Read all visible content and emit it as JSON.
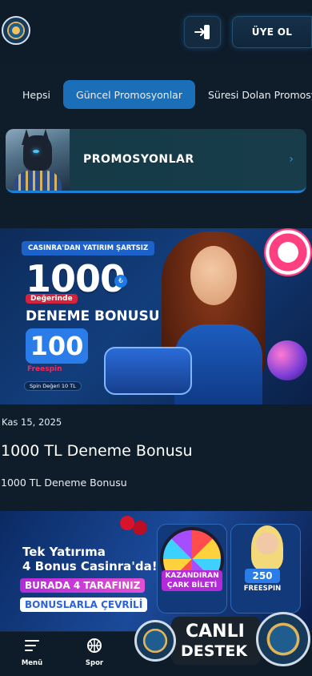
{
  "header": {
    "signup_label": "ÜYE OL"
  },
  "tabs": [
    {
      "label": "Hepsi",
      "active": false
    },
    {
      "label": "Güncel Promosyonlar",
      "active": true
    },
    {
      "label": "Süresi Dolan Promosyonlar",
      "active": false
    }
  ],
  "promo_card": {
    "title": "PROMOSYONLAR"
  },
  "banner1": {
    "tag": "CASINRA'DAN YATIRIM ŞARTSIZ",
    "big_amount": "1000",
    "currency_symbol": "₺",
    "degerinde": "Değerinde",
    "deneme": "DENEME BONUSU",
    "spins": "100",
    "freespin": "Freespin",
    "spin_value": "Spin Değeri 10 TL"
  },
  "post1": {
    "date": "Kas 15, 2025",
    "title": "1000 TL  Deneme Bonusu",
    "subtitle": "1000 TL  Deneme Bonusu"
  },
  "banner2": {
    "line1": "Tek Yatırıma",
    "line2": "4 Bonus Casinra'da!",
    "pill1": "BURADA 4 TARAFINIZ",
    "pill2": "BONUSLARLA ÇEVRİLİ",
    "wheel_badge_line1": "KAZANDIRAN",
    "wheel_badge_line2": "ÇARK BİLETİ",
    "freespin_amount": "250",
    "freespin_label": "FREESPIN"
  },
  "bottom_nav": [
    {
      "label": "Menü",
      "icon": "menu-icon"
    },
    {
      "label": "Spor",
      "icon": "basketball-icon"
    }
  ],
  "live_support": {
    "line1": "CANLI",
    "line2": "DESTEK"
  }
}
